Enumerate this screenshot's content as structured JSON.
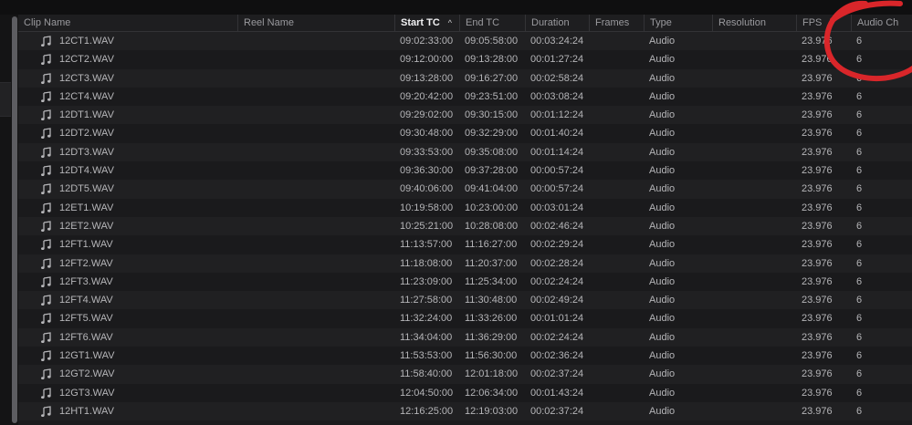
{
  "table": {
    "columns": [
      {
        "key": "clip_name",
        "label": "Clip Name"
      },
      {
        "key": "reel_name",
        "label": "Reel Name"
      },
      {
        "key": "start_tc",
        "label": "Start TC",
        "sorted": "ascending"
      },
      {
        "key": "end_tc",
        "label": "End TC"
      },
      {
        "key": "duration",
        "label": "Duration"
      },
      {
        "key": "frames",
        "label": "Frames"
      },
      {
        "key": "type",
        "label": "Type"
      },
      {
        "key": "resolution",
        "label": "Resolution"
      },
      {
        "key": "fps",
        "label": "FPS"
      },
      {
        "key": "audio_ch",
        "label": "Audio Ch"
      }
    ],
    "sort_indicator": "^",
    "row_icon": "music-note-icon",
    "rows": [
      {
        "clip_name": "12CT1.WAV",
        "reel_name": "",
        "start_tc": "09:02:33:00",
        "end_tc": "09:05:58:00",
        "duration": "00:03:24:24",
        "frames": "",
        "type": "Audio",
        "resolution": "",
        "fps": "23.976",
        "audio_ch": "6"
      },
      {
        "clip_name": "12CT2.WAV",
        "reel_name": "",
        "start_tc": "09:12:00:00",
        "end_tc": "09:13:28:00",
        "duration": "00:01:27:24",
        "frames": "",
        "type": "Audio",
        "resolution": "",
        "fps": "23.976",
        "audio_ch": "6"
      },
      {
        "clip_name": "12CT3.WAV",
        "reel_name": "",
        "start_tc": "09:13:28:00",
        "end_tc": "09:16:27:00",
        "duration": "00:02:58:24",
        "frames": "",
        "type": "Audio",
        "resolution": "",
        "fps": "23.976",
        "audio_ch": "6"
      },
      {
        "clip_name": "12CT4.WAV",
        "reel_name": "",
        "start_tc": "09:20:42:00",
        "end_tc": "09:23:51:00",
        "duration": "00:03:08:24",
        "frames": "",
        "type": "Audio",
        "resolution": "",
        "fps": "23.976",
        "audio_ch": "6"
      },
      {
        "clip_name": "12DT1.WAV",
        "reel_name": "",
        "start_tc": "09:29:02:00",
        "end_tc": "09:30:15:00",
        "duration": "00:01:12:24",
        "frames": "",
        "type": "Audio",
        "resolution": "",
        "fps": "23.976",
        "audio_ch": "6"
      },
      {
        "clip_name": "12DT2.WAV",
        "reel_name": "",
        "start_tc": "09:30:48:00",
        "end_tc": "09:32:29:00",
        "duration": "00:01:40:24",
        "frames": "",
        "type": "Audio",
        "resolution": "",
        "fps": "23.976",
        "audio_ch": "6"
      },
      {
        "clip_name": "12DT3.WAV",
        "reel_name": "",
        "start_tc": "09:33:53:00",
        "end_tc": "09:35:08:00",
        "duration": "00:01:14:24",
        "frames": "",
        "type": "Audio",
        "resolution": "",
        "fps": "23.976",
        "audio_ch": "6"
      },
      {
        "clip_name": "12DT4.WAV",
        "reel_name": "",
        "start_tc": "09:36:30:00",
        "end_tc": "09:37:28:00",
        "duration": "00:00:57:24",
        "frames": "",
        "type": "Audio",
        "resolution": "",
        "fps": "23.976",
        "audio_ch": "6"
      },
      {
        "clip_name": "12DT5.WAV",
        "reel_name": "",
        "start_tc": "09:40:06:00",
        "end_tc": "09:41:04:00",
        "duration": "00:00:57:24",
        "frames": "",
        "type": "Audio",
        "resolution": "",
        "fps": "23.976",
        "audio_ch": "6"
      },
      {
        "clip_name": "12ET1.WAV",
        "reel_name": "",
        "start_tc": "10:19:58:00",
        "end_tc": "10:23:00:00",
        "duration": "00:03:01:24",
        "frames": "",
        "type": "Audio",
        "resolution": "",
        "fps": "23.976",
        "audio_ch": "6"
      },
      {
        "clip_name": "12ET2.WAV",
        "reel_name": "",
        "start_tc": "10:25:21:00",
        "end_tc": "10:28:08:00",
        "duration": "00:02:46:24",
        "frames": "",
        "type": "Audio",
        "resolution": "",
        "fps": "23.976",
        "audio_ch": "6"
      },
      {
        "clip_name": "12FT1.WAV",
        "reel_name": "",
        "start_tc": "11:13:57:00",
        "end_tc": "11:16:27:00",
        "duration": "00:02:29:24",
        "frames": "",
        "type": "Audio",
        "resolution": "",
        "fps": "23.976",
        "audio_ch": "6"
      },
      {
        "clip_name": "12FT2.WAV",
        "reel_name": "",
        "start_tc": "11:18:08:00",
        "end_tc": "11:20:37:00",
        "duration": "00:02:28:24",
        "frames": "",
        "type": "Audio",
        "resolution": "",
        "fps": "23.976",
        "audio_ch": "6"
      },
      {
        "clip_name": "12FT3.WAV",
        "reel_name": "",
        "start_tc": "11:23:09:00",
        "end_tc": "11:25:34:00",
        "duration": "00:02:24:24",
        "frames": "",
        "type": "Audio",
        "resolution": "",
        "fps": "23.976",
        "audio_ch": "6"
      },
      {
        "clip_name": "12FT4.WAV",
        "reel_name": "",
        "start_tc": "11:27:58:00",
        "end_tc": "11:30:48:00",
        "duration": "00:02:49:24",
        "frames": "",
        "type": "Audio",
        "resolution": "",
        "fps": "23.976",
        "audio_ch": "6"
      },
      {
        "clip_name": "12FT5.WAV",
        "reel_name": "",
        "start_tc": "11:32:24:00",
        "end_tc": "11:33:26:00",
        "duration": "00:01:01:24",
        "frames": "",
        "type": "Audio",
        "resolution": "",
        "fps": "23.976",
        "audio_ch": "6"
      },
      {
        "clip_name": "12FT6.WAV",
        "reel_name": "",
        "start_tc": "11:34:04:00",
        "end_tc": "11:36:29:00",
        "duration": "00:02:24:24",
        "frames": "",
        "type": "Audio",
        "resolution": "",
        "fps": "23.976",
        "audio_ch": "6"
      },
      {
        "clip_name": "12GT1.WAV",
        "reel_name": "",
        "start_tc": "11:53:53:00",
        "end_tc": "11:56:30:00",
        "duration": "00:02:36:24",
        "frames": "",
        "type": "Audio",
        "resolution": "",
        "fps": "23.976",
        "audio_ch": "6"
      },
      {
        "clip_name": "12GT2.WAV",
        "reel_name": "",
        "start_tc": "11:58:40:00",
        "end_tc": "12:01:18:00",
        "duration": "00:02:37:24",
        "frames": "",
        "type": "Audio",
        "resolution": "",
        "fps": "23.976",
        "audio_ch": "6"
      },
      {
        "clip_name": "12GT3.WAV",
        "reel_name": "",
        "start_tc": "12:04:50:00",
        "end_tc": "12:06:34:00",
        "duration": "00:01:43:24",
        "frames": "",
        "type": "Audio",
        "resolution": "",
        "fps": "23.976",
        "audio_ch": "6"
      },
      {
        "clip_name": "12HT1.WAV",
        "reel_name": "",
        "start_tc": "12:16:25:00",
        "end_tc": "12:19:03:00",
        "duration": "00:02:37:24",
        "frames": "",
        "type": "Audio",
        "resolution": "",
        "fps": "23.976",
        "audio_ch": "6"
      }
    ]
  },
  "annotation": {
    "shape": "hand-drawn-circle",
    "color": "#d9262a"
  }
}
